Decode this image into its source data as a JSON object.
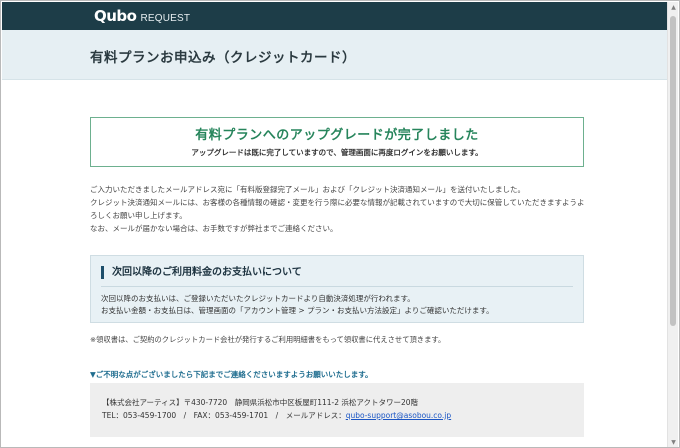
{
  "header": {
    "logo_mark": "Qubo",
    "logo_sub": "REQUEST"
  },
  "page": {
    "title": "有料プランお申込み（クレジットカード）"
  },
  "completion": {
    "title": "有料プランへのアップグレードが完了しました",
    "subtitle": "アップグレードは既に完了していますので、管理画面に再度ログインをお願いします。"
  },
  "notice": {
    "line1": "ご入力いただきましたメールアドレス宛に「有料版登録完了メール」および「クレジット決済通知メール」を送付いたしました。",
    "line2": "クレジット決済通知メールには、お客様の各種情報の確認・変更を行う際に必要な情報が記載されていますので大切に保管していただきますようよろしくお願い申し上げます。",
    "line3": "なお、メールが届かない場合は、お手数ですが弊社までご連絡ください。"
  },
  "billing": {
    "title": "次回以降のご利用料金のお支払いについて",
    "line1": "次回以降のお支払いは、ご登録いただいたクレジットカードより自動決済処理が行われます。",
    "line2": "お支払い金額・お支払日は、管理画面の「アカウント管理 > プラン・お支払い方法設定」よりご確認いただけます。"
  },
  "receipt_note": "※領収書は、ご契約のクレジットカード会社が発行するご利用明細書をもって領収書に代えさせて頂きます。",
  "contact": {
    "heading": "▼ご不明な点がございましたら下記までご連絡くださいますようお願いいたします。",
    "company_line": "【株式会社アーティス】〒430-7720　静岡県浜松市中区板屋町111-2 浜松アクトタワー20階",
    "phone_fax": "TEL：053-459-1700　/　FAX：053-459-1701　/　メールアドレス：",
    "email": "qubo-support@asobou.co.jp"
  },
  "icons": {
    "scroll_up": "▲",
    "scroll_down": "▼"
  },
  "colors": {
    "topbar": "#1d3d48",
    "titlebar": "#e6eff3",
    "success_green": "#27855c",
    "billing_bg": "#e8f1f5",
    "contact_heading": "#1f6d8f",
    "link": "#1a55c4"
  }
}
